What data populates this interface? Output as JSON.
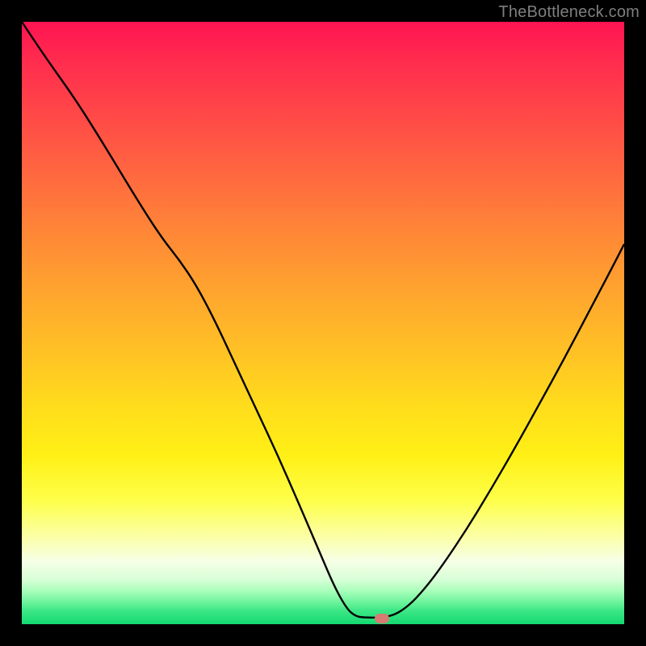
{
  "watermark": "TheBottleneck.com",
  "marker": {
    "x_pct": 59.8,
    "y_pct": 99.0
  },
  "chart_data": {
    "type": "line",
    "title": "",
    "xlabel": "",
    "ylabel": "",
    "xlim": [
      0,
      1
    ],
    "ylim": [
      0,
      1
    ],
    "series": [
      {
        "name": "bottleneck-curve",
        "points": [
          {
            "x": 0.0,
            "y": 1.0
          },
          {
            "x": 0.04,
            "y": 0.94
          },
          {
            "x": 0.09,
            "y": 0.87
          },
          {
            "x": 0.14,
            "y": 0.79
          },
          {
            "x": 0.19,
            "y": 0.707
          },
          {
            "x": 0.231,
            "y": 0.643
          },
          {
            "x": 0.262,
            "y": 0.604
          },
          {
            "x": 0.29,
            "y": 0.562
          },
          {
            "x": 0.32,
            "y": 0.505
          },
          {
            "x": 0.355,
            "y": 0.43
          },
          {
            "x": 0.39,
            "y": 0.355
          },
          {
            "x": 0.425,
            "y": 0.28
          },
          {
            "x": 0.46,
            "y": 0.2
          },
          {
            "x": 0.495,
            "y": 0.118
          },
          {
            "x": 0.52,
            "y": 0.06
          },
          {
            "x": 0.54,
            "y": 0.025
          },
          {
            "x": 0.553,
            "y": 0.014
          },
          {
            "x": 0.565,
            "y": 0.011
          },
          {
            "x": 0.61,
            "y": 0.011
          },
          {
            "x": 0.64,
            "y": 0.028
          },
          {
            "x": 0.67,
            "y": 0.06
          },
          {
            "x": 0.7,
            "y": 0.1
          },
          {
            "x": 0.74,
            "y": 0.16
          },
          {
            "x": 0.78,
            "y": 0.226
          },
          {
            "x": 0.82,
            "y": 0.295
          },
          {
            "x": 0.86,
            "y": 0.367
          },
          {
            "x": 0.9,
            "y": 0.44
          },
          {
            "x": 0.94,
            "y": 0.516
          },
          {
            "x": 0.98,
            "y": 0.592
          },
          {
            "x": 1.0,
            "y": 0.631
          }
        ]
      }
    ],
    "background_gradient": {
      "top_color": "#ff1452",
      "mid_color": "#ffdd1c",
      "bottom_color": "#13d971"
    },
    "optimal_marker": {
      "x": 0.598,
      "y": 0.01,
      "color": "#d77a74"
    }
  }
}
